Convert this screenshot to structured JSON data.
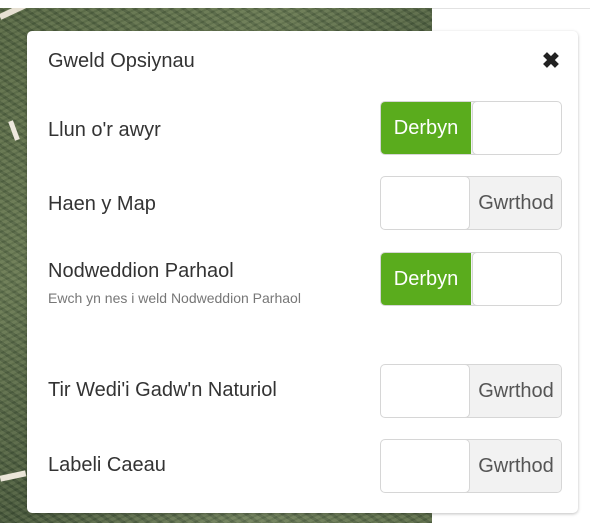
{
  "dialog": {
    "title": "Gweld Opsiynau",
    "close_glyph": "✖"
  },
  "options": [
    {
      "label": "Llun o'r awyr",
      "hint": "",
      "state": "on",
      "toggle_text": "Derbyn"
    },
    {
      "label": "Haen y Map",
      "hint": "",
      "state": "off",
      "toggle_text": "Gwrthod"
    },
    {
      "label": "Nodweddion Parhaol",
      "hint": "Ewch yn nes i weld Nodweddion Parhaol",
      "state": "on",
      "toggle_text": "Derbyn"
    },
    {
      "label": "Tir Wedi'i Gadw'n Naturiol",
      "hint": "",
      "state": "off",
      "toggle_text": "Gwrthod"
    },
    {
      "label": "Labeli Caeau",
      "hint": "",
      "state": "off",
      "toggle_text": "Gwrthod"
    }
  ],
  "colors": {
    "on": "#5aac1d",
    "off": "#f2f2f2"
  }
}
